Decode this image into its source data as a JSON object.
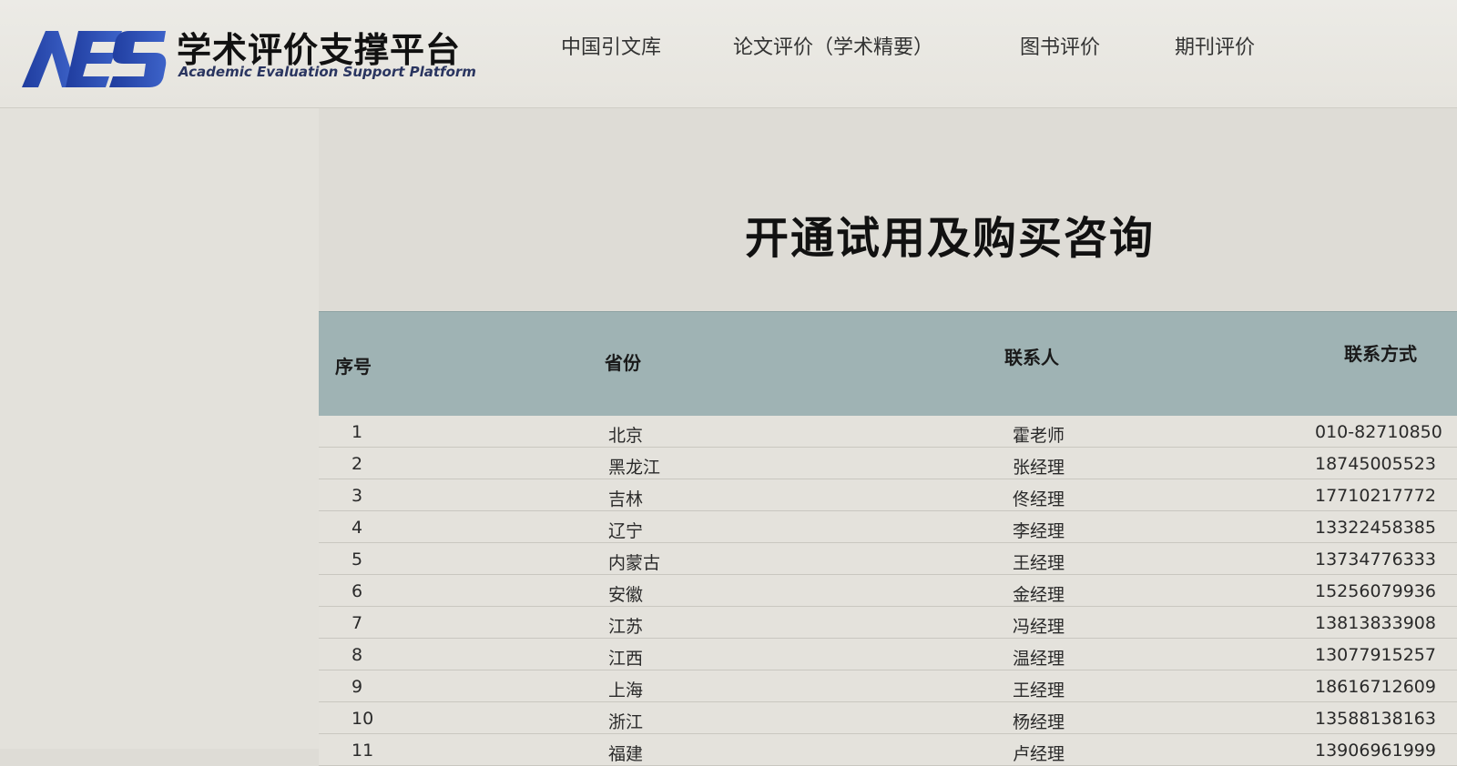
{
  "header": {
    "logo_text": "AES",
    "title": "学术评价支撑平台",
    "subtitle": "Academic Evaluation Support Platform",
    "nav": [
      {
        "label": "中国引文库"
      },
      {
        "label": "论文评价（学术精要）"
      },
      {
        "label": "图书评价"
      },
      {
        "label": "期刊评价"
      }
    ]
  },
  "main": {
    "title": "开通试用及购买咨询",
    "table": {
      "columns": [
        "序号",
        "省份",
        "联系人",
        "联系方式"
      ],
      "rows": [
        [
          "1",
          "北京",
          "霍老师",
          "010-82710850"
        ],
        [
          "2",
          "黑龙江",
          "张经理",
          "18745005523"
        ],
        [
          "3",
          "吉林",
          "佟经理",
          "17710217772"
        ],
        [
          "4",
          "辽宁",
          "李经理",
          "13322458385"
        ],
        [
          "5",
          "内蒙古",
          "王经理",
          "13734776333"
        ],
        [
          "6",
          "安徽",
          "金经理",
          "15256079936"
        ],
        [
          "7",
          "江苏",
          "冯经理",
          "13813833908"
        ],
        [
          "8",
          "江西",
          "温经理",
          "13077915257"
        ],
        [
          "9",
          "上海",
          "王经理",
          "18616712609"
        ],
        [
          "10",
          "浙江",
          "杨经理",
          "13588138163"
        ],
        [
          "11",
          "福建",
          "卢经理",
          "13906961999"
        ]
      ]
    }
  },
  "colors": {
    "header_bg": "#ecebe6",
    "table_header_bg": "#9fb3b4",
    "logo_blue": "#1e3fa8"
  }
}
